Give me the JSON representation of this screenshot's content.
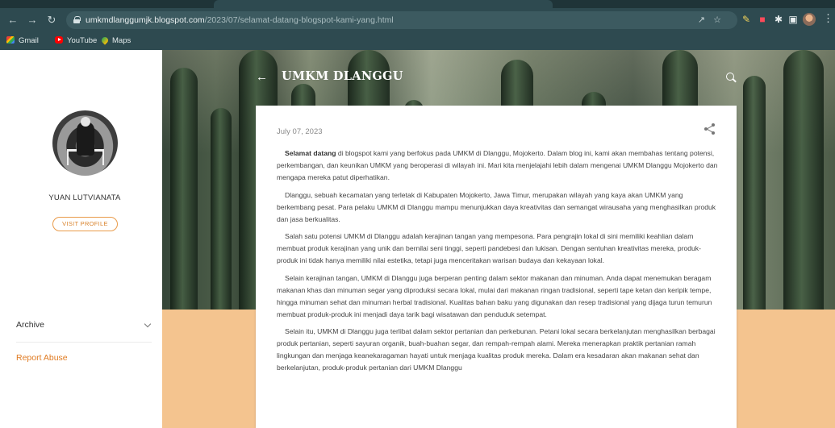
{
  "browser": {
    "url_host": "umkmdlanggumjk.blogspot.com",
    "url_path": "/2023/07/selamat-datang-blogspot-kami-yang.html",
    "bookmarks": [
      "Gmail",
      "YouTube",
      "Maps"
    ]
  },
  "sidebar": {
    "profile_name": "YUAN LUTVIANATA",
    "visit_profile_label": "VISIT PROFILE",
    "archive_label": "Archive",
    "report_abuse_label": "Report Abuse"
  },
  "header": {
    "blog_title": "UMKM DLANGGU"
  },
  "post": {
    "date": "July 07, 2023",
    "intro_bold": "Selamat datang",
    "paragraphs": [
      " di blogspot kami yang berfokus pada UMKM di Dlanggu, Mojokerto. Dalam blog ini, kami akan membahas tentang potensi, perkembangan, dan keunikan UMKM yang beroperasi di wilayah ini. Mari kita menjelajahi lebih dalam mengenai UMKM Dlanggu Mojokerto dan mengapa mereka patut diperhatikan.",
      "Dlanggu, sebuah kecamatan yang terletak di Kabupaten Mojokerto, Jawa Timur, merupakan wilayah yang kaya akan UMKM yang berkembang pesat. Para pelaku UMKM di Dlanggu mampu menunjukkan daya kreativitas dan semangat wirausaha yang menghasilkan produk dan jasa berkualitas.",
      "Salah satu potensi UMKM di Dlanggu adalah kerajinan tangan yang mempesona. Para pengrajin lokal di sini memiliki keahlian dalam membuat produk kerajinan yang unik dan bernilai seni tinggi, seperti pandebesi dan lukisan. Dengan sentuhan kreativitas mereka, produk-produk ini tidak hanya memiliki nilai estetika, tetapi juga menceritakan warisan budaya dan kekayaan lokal.",
      "Selain kerajinan tangan, UMKM di Dlanggu juga berperan penting dalam sektor makanan dan minuman. Anda dapat menemukan beragam makanan khas dan minuman segar yang diproduksi secara lokal, mulai dari makanan ringan tradisional, seperti tape ketan dan keripik tempe, hingga minuman sehat dan minuman herbal tradisional. Kualitas bahan baku yang digunakan dan resep tradisional yang dijaga turun temurun membuat produk-produk ini menjadi daya tarik bagi wisatawan dan penduduk setempat.",
      "Selain itu, UMKM di Dlanggu juga terlibat dalam sektor pertanian dan perkebunan. Petani lokal secara berkelanjutan menghasilkan berbagai produk pertanian, seperti sayuran organik, buah-buahan segar, dan rempah-rempah alami. Mereka menerapkan praktik pertanian ramah lingkungan dan menjaga keanekaragaman hayati untuk menjaga kualitas produk mereka. Dalam era kesadaran akan makanan sehat dan berkelanjutan, produk-produk pertanian dari UMKM Dlanggu"
    ]
  },
  "colors": {
    "chrome": "#2e4a50",
    "accent": "#e07b22",
    "hero_bottom": "#f4c48f"
  }
}
